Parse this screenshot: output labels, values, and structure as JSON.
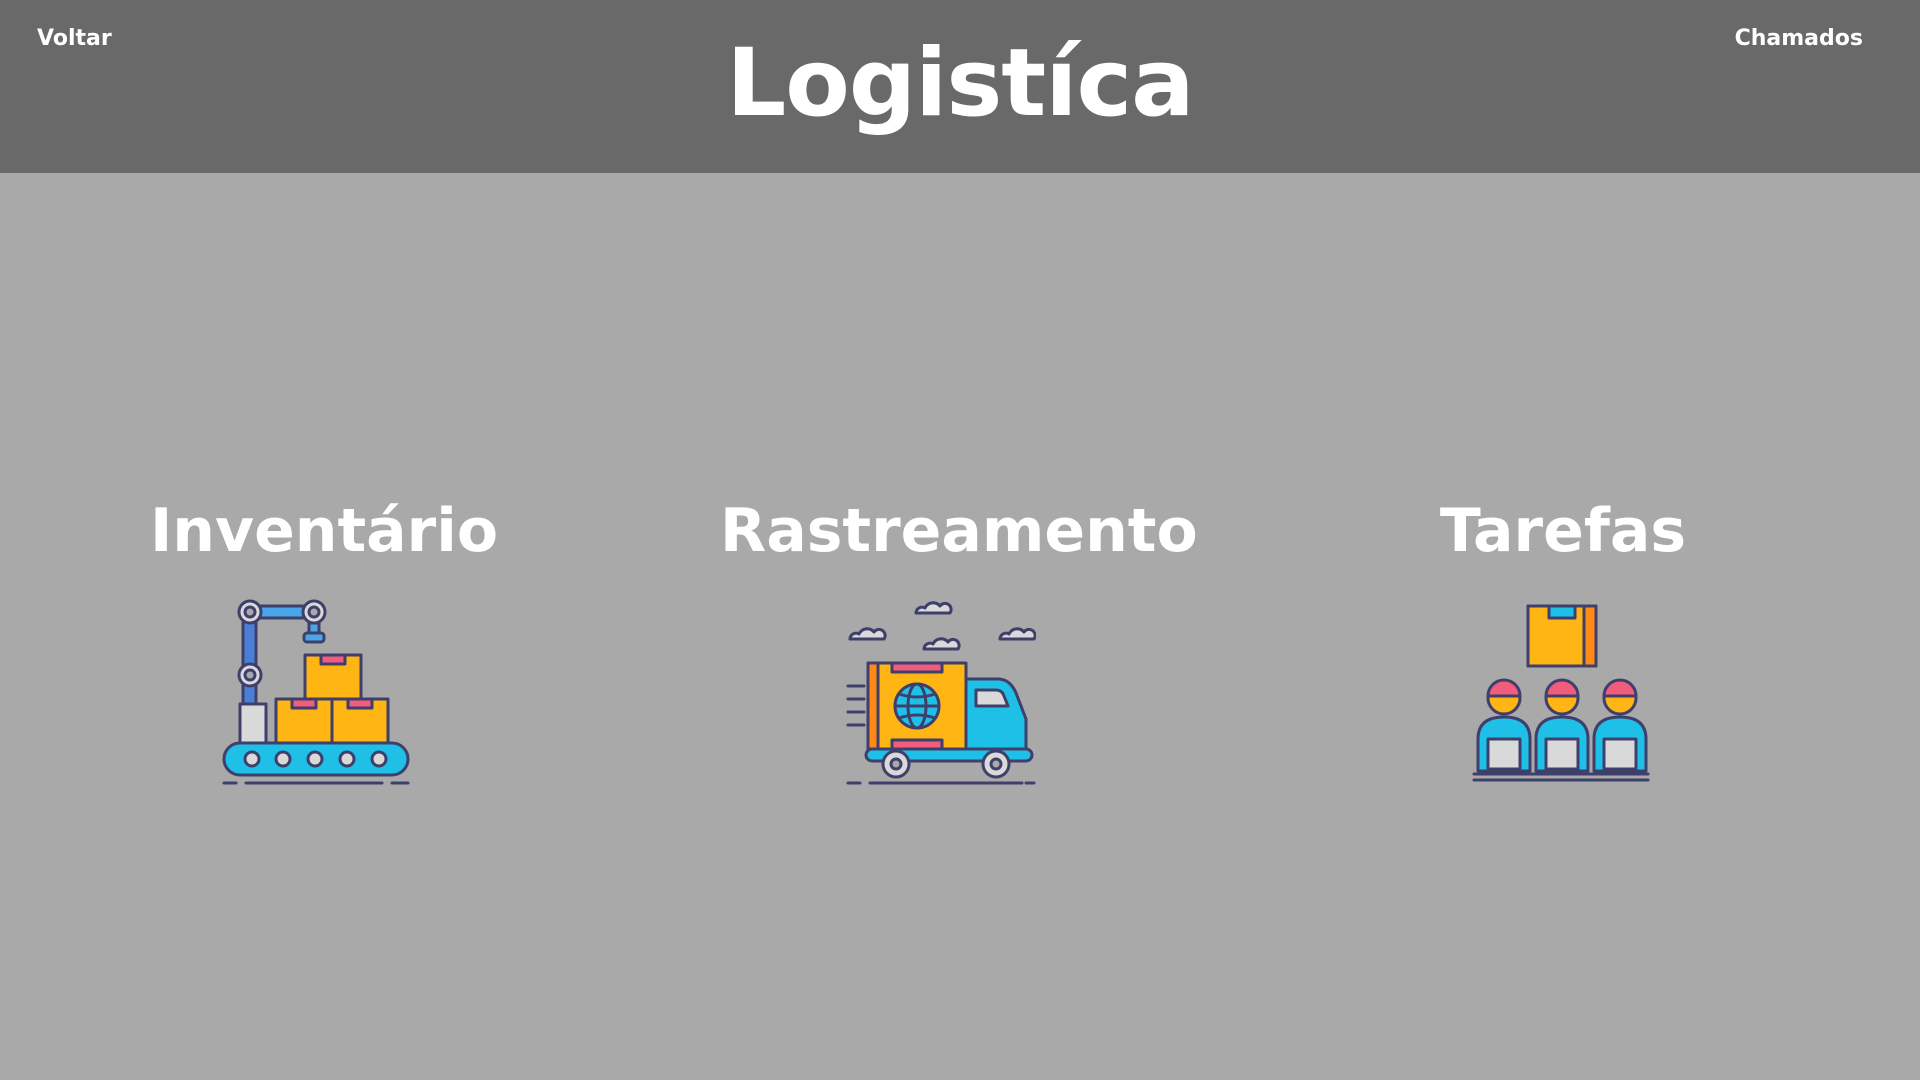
{
  "header": {
    "title": "Logistíca",
    "back_label": "Voltar",
    "calls_label": "Chamados"
  },
  "cards": [
    {
      "label": "Inventário",
      "icon": "conveyor-robot-arm-icon"
    },
    {
      "label": "Rastreamento",
      "icon": "delivery-truck-icon"
    },
    {
      "label": "Tarefas",
      "icon": "team-workers-icon"
    }
  ],
  "colors": {
    "header_bg": "#696969",
    "page_bg": "#a9a9a9",
    "text": "#ffffff",
    "box_orange": "#ffb514",
    "accent_blue": "#1fc0e8",
    "accent_pink": "#f25c7d",
    "outline": "#3f3f6b"
  }
}
